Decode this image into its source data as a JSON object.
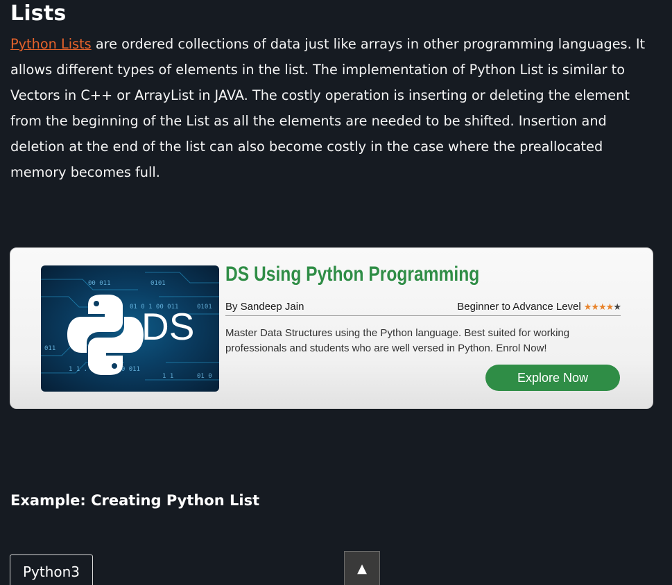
{
  "article": {
    "heading": "Lists",
    "intro_link": "Python Lists",
    "intro_text": " are ordered collections of data just like arrays in other programming languages. It allows different types of elements in the list. The implementation of Python List is similar to Vectors in C++ or ArrayList in JAVA. The costly operation is inserting or deleting the element from the beginning of the List as all the elements are needed to be shifted. Insertion and deletion at the end of the list can also become costly in the case where the preallocated memory becomes full.",
    "example_heading": "Example: Creating Python List"
  },
  "banner": {
    "thumb_text": "DS",
    "title": "DS Using Python Programming",
    "author": "By Sandeep Jain",
    "level": "Beginner to Advance Level",
    "rating": 4.5,
    "description": "Master Data Structures using the Python language. Best suited for working professionals and students who are well versed in Python. Enrol Now!",
    "button_label": "Explore Now",
    "accent_color": "#2f8d46",
    "star_color": "#e8832b"
  },
  "code_block": {
    "language_tab": "Python3"
  },
  "scroll_top": {
    "icon": "arrow-up-icon",
    "glyph": "▲"
  },
  "colors": {
    "background": "#161b22",
    "link": "#e8632b"
  }
}
